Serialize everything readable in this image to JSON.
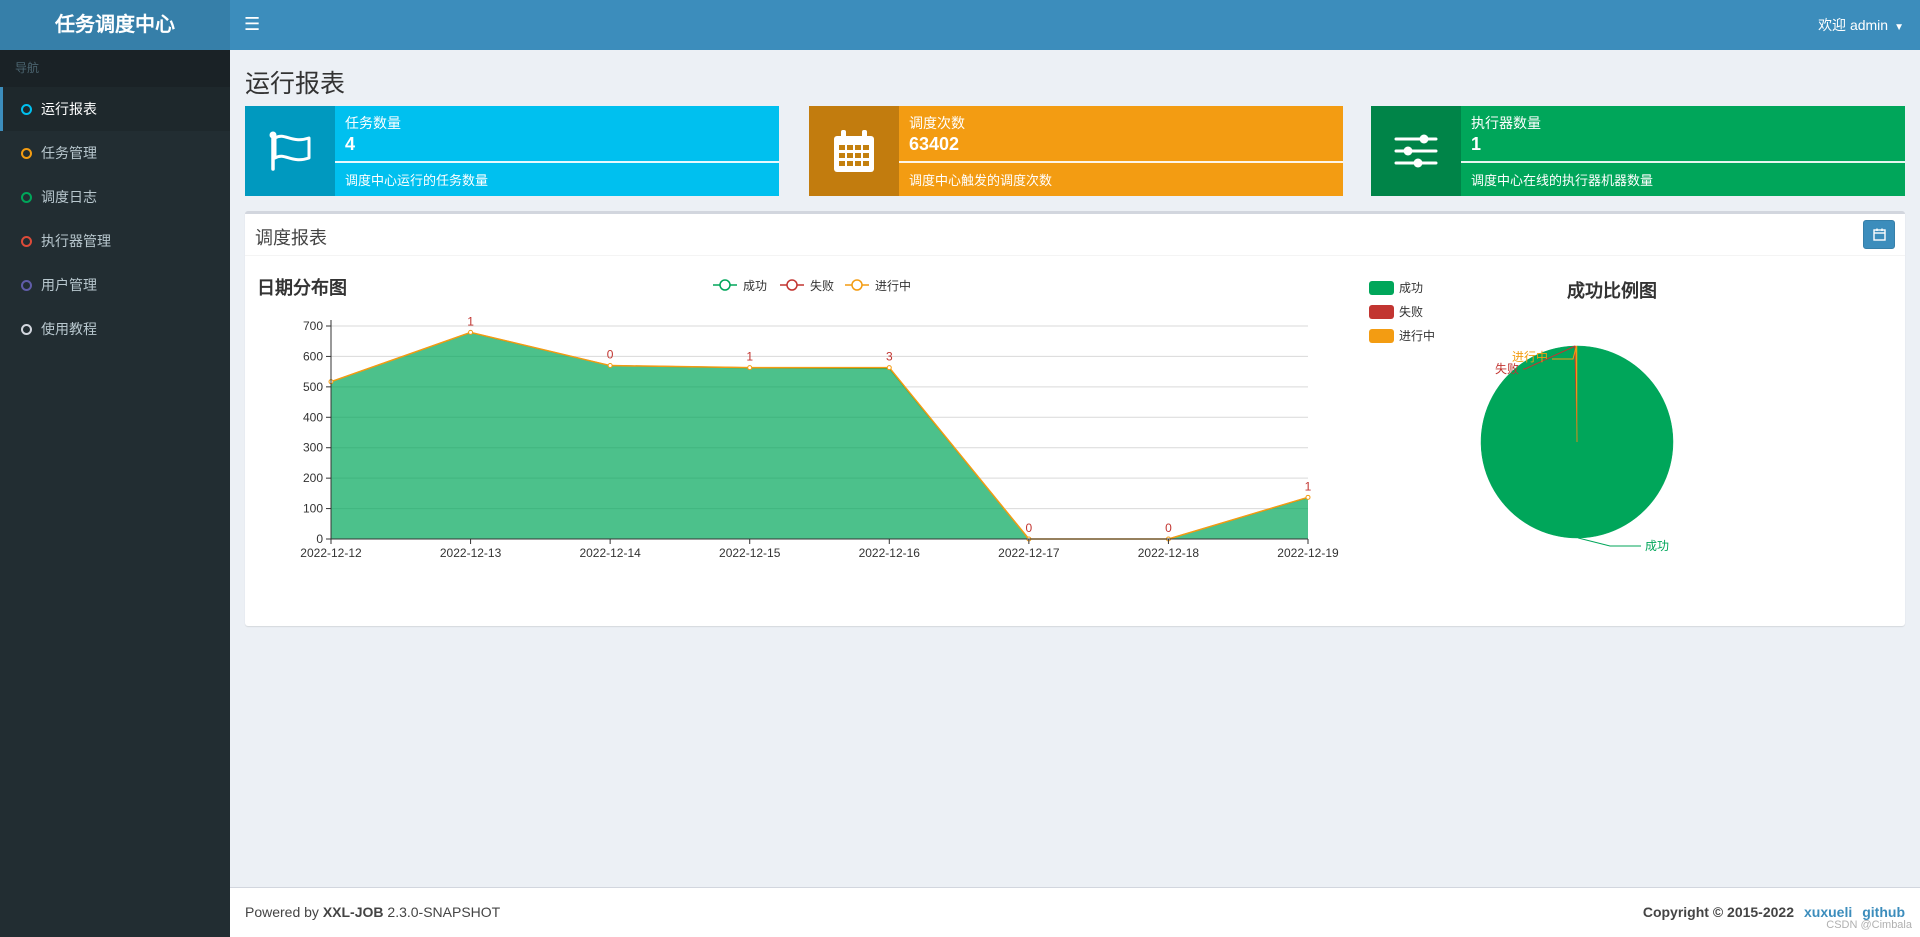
{
  "app": {
    "title": "任务调度中心",
    "user_greeting": "欢迎 admin"
  },
  "sidebar": {
    "header": "导航",
    "items": [
      {
        "label": "运行报表",
        "color": "#00c0ef",
        "active": true
      },
      {
        "label": "任务管理",
        "color": "#f39c12",
        "active": false
      },
      {
        "label": "调度日志",
        "color": "#00a65a",
        "active": false
      },
      {
        "label": "执行器管理",
        "color": "#dd4b39",
        "active": false
      },
      {
        "label": "用户管理",
        "color": "#605ca8",
        "active": false
      },
      {
        "label": "使用教程",
        "color": "#d2d6de",
        "active": false
      }
    ]
  },
  "page": {
    "title": "运行报表"
  },
  "stats": [
    {
      "label": "任务数量",
      "value": "4",
      "desc": "调度中心运行的任务数量",
      "color": "#00c0ef",
      "icon": "flag-icon"
    },
    {
      "label": "调度次数",
      "value": "63402",
      "desc": "调度中心触发的调度次数",
      "color": "#f39c12",
      "icon": "calendar-icon"
    },
    {
      "label": "执行器数量",
      "value": "1",
      "desc": "调度中心在线的执行器机器数量",
      "color": "#00a65a",
      "icon": "sliders-icon"
    }
  ],
  "report": {
    "title": "调度报表"
  },
  "chart_data": [
    {
      "type": "area",
      "title": "日期分布图",
      "categories": [
        "2022-12-12",
        "2022-12-13",
        "2022-12-14",
        "2022-12-15",
        "2022-12-16",
        "2022-12-17",
        "2022-12-18",
        "2022-12-19"
      ],
      "series": [
        {
          "name": "成功",
          "values": [
            517,
            678,
            570,
            562,
            560,
            0,
            0,
            136
          ],
          "color": "#00a65a"
        },
        {
          "name": "失败",
          "values": [
            0,
            1,
            0,
            1,
            3,
            0,
            0,
            1
          ],
          "color": "#c23531"
        },
        {
          "name": "进行中",
          "values": [
            0,
            0,
            0,
            0,
            0,
            0,
            0,
            0
          ],
          "color": "#f39c12"
        }
      ],
      "data_labels": [
        "",
        "1",
        "0",
        "1",
        "3",
        "0",
        "0",
        "1"
      ],
      "yticks": [
        "0",
        "100",
        "200",
        "300",
        "400",
        "500",
        "600",
        "700"
      ],
      "ylim": [
        0,
        700
      ],
      "stacked": true,
      "grid": true,
      "legend": "top"
    },
    {
      "type": "pie",
      "title": "成功比例图",
      "slices": [
        {
          "name": "成功",
          "value": 99.6,
          "color": "#00a65a"
        },
        {
          "name": "失败",
          "value": 0.2,
          "color": "#c23531"
        },
        {
          "name": "进行中",
          "value": 0.2,
          "color": "#f39c12"
        }
      ],
      "legend": "top-left"
    }
  ],
  "footer": {
    "powered_prefix": "Powered by ",
    "product": "XXL-JOB",
    "version": " 2.3.0-SNAPSHOT",
    "copyright": "Copyright © 2015-2022",
    "link1": "xuxueli",
    "link2": "github",
    "watermark": "CSDN @Cimbala"
  }
}
